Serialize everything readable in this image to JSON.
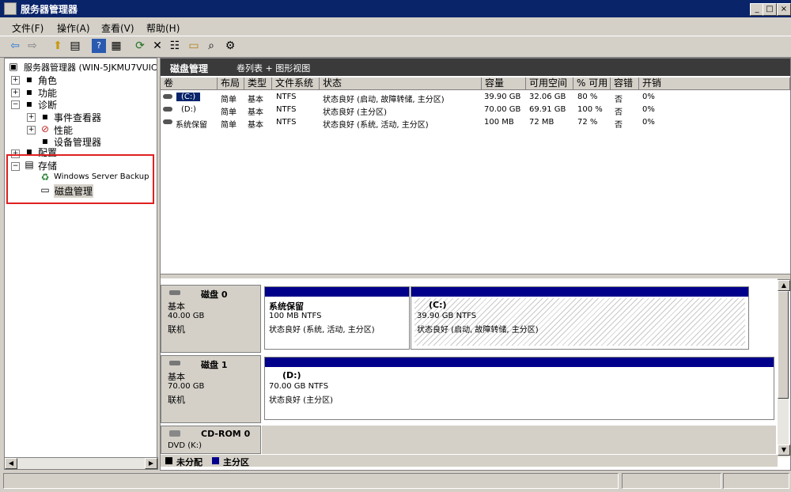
{
  "window": {
    "title": "服务器管理器",
    "controls": [
      "_",
      "□",
      "×"
    ]
  },
  "menu": [
    "文件(F)",
    "操作(A)",
    "查看(V)",
    "帮助(H)"
  ],
  "toolbar_icons": [
    "back-icon",
    "forward-icon",
    "up-icon",
    "show-tree-icon",
    "help-icon",
    "console-icon",
    "refresh-icon",
    "delete-icon",
    "properties-icon",
    "open-icon",
    "search-icon",
    "settings-icon"
  ],
  "tree": {
    "root": "服务器管理器 (WIN-5JKMU7VUIC",
    "roles": "角色",
    "features": "功能",
    "diagnostics": "诊断",
    "event_viewer": "事件查看器",
    "performance": "性能",
    "device_manager": "设备管理器",
    "config": "配置",
    "storage": "存储",
    "wsb": "Windows Server Backup",
    "disk_mgmt": "磁盘管理"
  },
  "right": {
    "title": "磁盘管理",
    "views": "卷列表 + 图形视图",
    "columns": [
      "卷",
      "布局",
      "类型",
      "文件系统",
      "状态",
      "容量",
      "可用空间",
      "% 可用",
      "容错",
      "开销"
    ],
    "volumes": [
      {
        "name": "(C:)",
        "layout": "简单",
        "type": "基本",
        "fs": "NTFS",
        "status": "状态良好 (启动, 故障转储, 主分区)",
        "capacity": "39.90 GB",
        "free": "32.06 GB",
        "pct": "80 %",
        "fault": "否",
        "overhead": "0%"
      },
      {
        "name": "(D:)",
        "layout": "简单",
        "type": "基本",
        "fs": "NTFS",
        "status": "状态良好 (主分区)",
        "capacity": "70.00 GB",
        "free": "69.91 GB",
        "pct": "100 %",
        "fault": "否",
        "overhead": "0%"
      },
      {
        "name": "系统保留",
        "layout": "简单",
        "type": "基本",
        "fs": "NTFS",
        "status": "状态良好 (系统, 活动, 主分区)",
        "capacity": "100 MB",
        "free": "72 MB",
        "pct": "72 %",
        "fault": "否",
        "overhead": "0%"
      }
    ],
    "disks": [
      {
        "name": "磁盘 0",
        "type": "基本",
        "size": "40.00 GB",
        "state": "联机",
        "parts": [
          {
            "name": "系统保留",
            "detail": "100 MB NTFS",
            "status": "状态良好 (系统, 活动, 主分区)"
          },
          {
            "name": "(C:)",
            "detail": "39.90 GB NTFS",
            "status": "状态良好 (启动, 故障转储, 主分区)"
          }
        ]
      },
      {
        "name": "磁盘 1",
        "type": "基本",
        "size": "70.00 GB",
        "state": "联机",
        "parts": [
          {
            "name": "(D:)",
            "detail": "70.00 GB NTFS",
            "status": "状态良好 (主分区)"
          }
        ]
      },
      {
        "name": "CD-ROM 0",
        "type": "DVD (K:)"
      }
    ],
    "legend": [
      "未分配",
      "主分区"
    ]
  },
  "colors": {
    "titlebar": "#0a246a",
    "primary_partition": "#00008b",
    "unallocated": "#000000",
    "highlight_box": "#e02020"
  }
}
